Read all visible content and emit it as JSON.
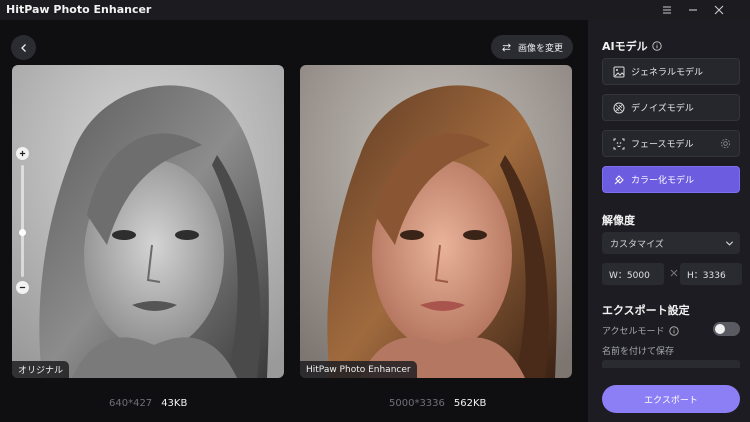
{
  "app": {
    "title": "HitPaw Photo Enhancer"
  },
  "toolbar": {
    "change_image_label": "画像を変更"
  },
  "photos": {
    "original": {
      "label": "オリジナル",
      "dimensions": "640*427",
      "size": "43KB"
    },
    "enhanced": {
      "label": "HitPaw Photo Enhancer",
      "dimensions": "5000*3336",
      "size": "562KB"
    }
  },
  "zoom": {
    "level": 0.4
  },
  "sidebar": {
    "ai_model_title": "AIモデル",
    "models": [
      {
        "label": "ジェネラルモデル",
        "icon": "image-icon",
        "active": false
      },
      {
        "label": "デノイズモデル",
        "icon": "denoise-icon",
        "active": false
      },
      {
        "label": "フェースモデル",
        "icon": "face-icon",
        "active": false
      },
      {
        "label": "カラー化モデル",
        "icon": "colorize-icon",
        "active": true
      }
    ],
    "resolution_title": "解像度",
    "resolution_select": "カスタマイズ",
    "width_field": "W：5000",
    "height_field": "H：3336",
    "export_settings_title": "エクスポート設定",
    "accel_mode_label": "アクセルモード",
    "accel_mode_on": false,
    "save_as_label": "名前を付けて保存",
    "export_button": "エクスポート"
  },
  "colors": {
    "accent": "#6c5ce0",
    "export": "#8c7ef5",
    "sidebar_bg": "#1c1c22",
    "canvas_bg": "#0f0f12"
  }
}
